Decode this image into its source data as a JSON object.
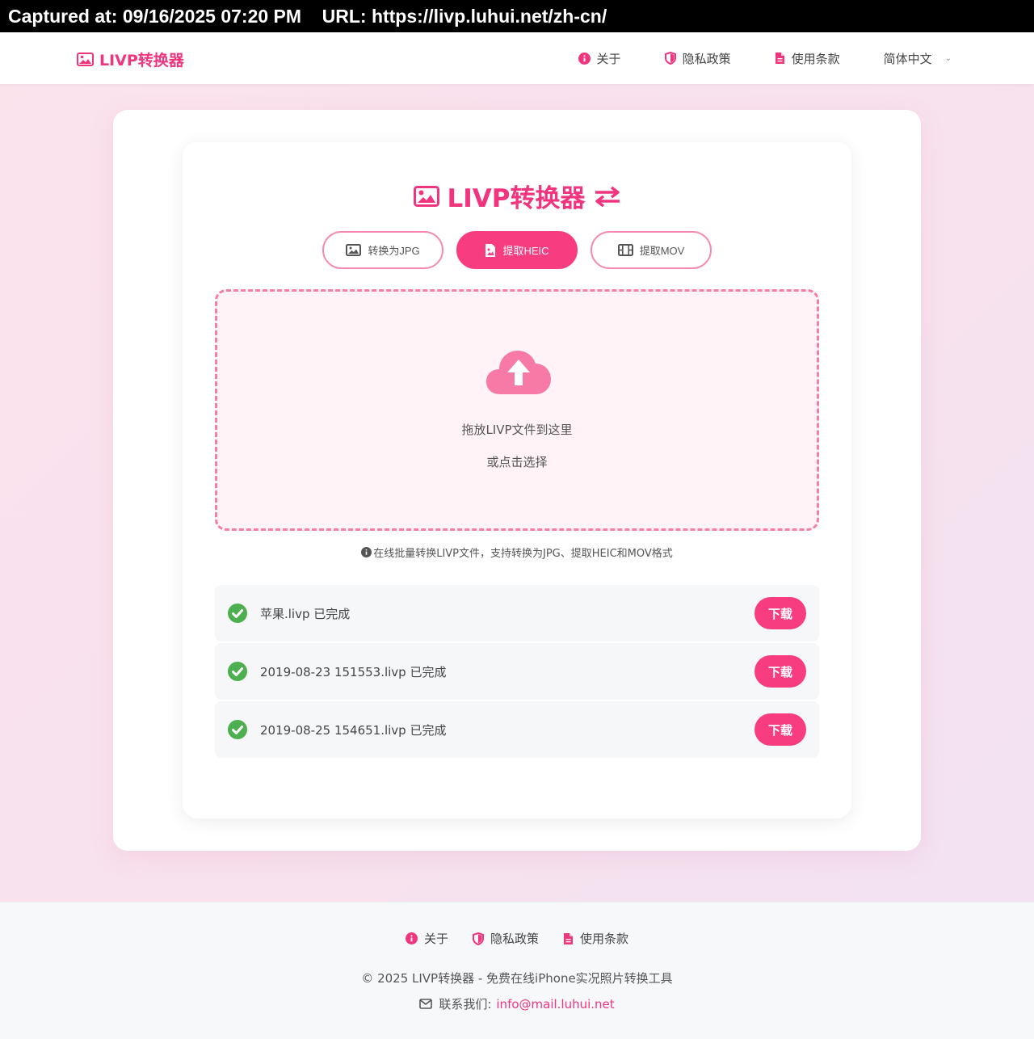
{
  "capture": {
    "text": "Captured at: 09/16/2025 07:20 PM    URL: https://livp.luhui.net/zh-cn/"
  },
  "navbar": {
    "brand": "LIVP转换器",
    "links": [
      {
        "label": "关于",
        "icon": "info-circle-icon"
      },
      {
        "label": "隐私政策",
        "icon": "shield-icon"
      },
      {
        "label": "使用条款",
        "icon": "document-icon"
      }
    ],
    "language": "简体中文"
  },
  "main": {
    "title": "LIVP转换器",
    "modes": [
      {
        "label": "转换为JPG",
        "icon": "image-icon",
        "active": false
      },
      {
        "label": "提取HEIC",
        "icon": "file-image-icon",
        "active": true
      },
      {
        "label": "提取MOV",
        "icon": "film-icon",
        "active": false
      }
    ],
    "dropzone": {
      "main_text": "拖放LIVP文件到这里",
      "sub_text": "或点击选择"
    },
    "info": "在线批量转换LIVP文件，支持转换为JPG、提取HEIC和MOV格式",
    "files": [
      {
        "name": "苹果.livp 已完成",
        "button": "下载"
      },
      {
        "name": "2019-08-23 151553.livp 已完成",
        "button": "下载"
      },
      {
        "name": "2019-08-25 154651.livp 已完成",
        "button": "下载"
      }
    ]
  },
  "footer": {
    "links": [
      {
        "label": "关于"
      },
      {
        "label": "隐私政策"
      },
      {
        "label": "使用条款"
      }
    ],
    "copyright": "© 2025 LIVP转换器 - 免费在线iPhone实况照片转换工具",
    "contact_label": "联系我们:",
    "contact_email": "info@mail.luhui.net"
  },
  "colors": {
    "accent": "#f83c80",
    "brand_text": "#f0357e",
    "dropzone_border": "#f57ea8",
    "dropzone_bg": "#fff3f7",
    "success": "#4caf50"
  }
}
